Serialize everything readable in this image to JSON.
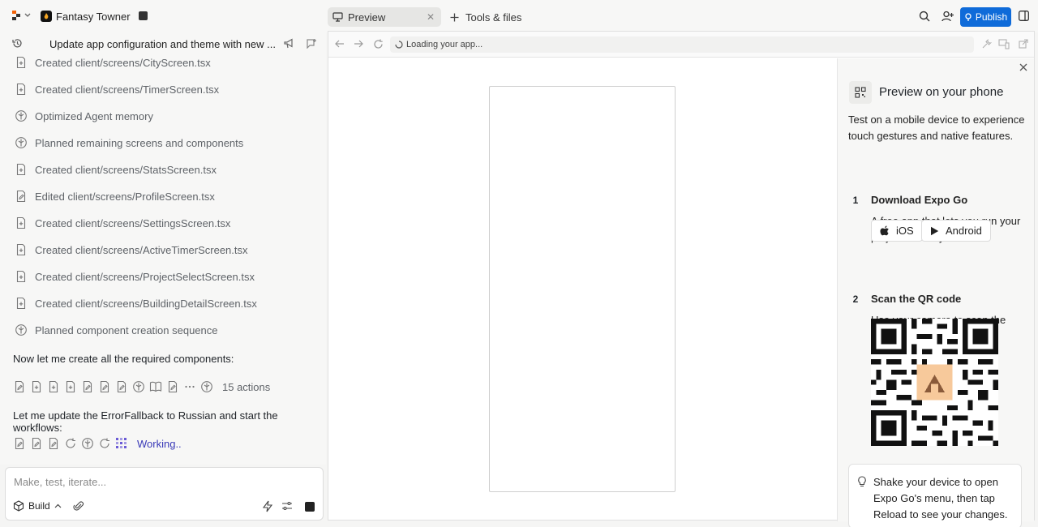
{
  "app": {
    "project_name": "Fantasy Towner",
    "colors": {
      "accent": "#0f6bd9",
      "working": "#3a3ab8"
    }
  },
  "tabs": {
    "preview_label": "Preview",
    "tools_label": "Tools & files"
  },
  "top_actions": {
    "publish_label": "Publish"
  },
  "left": {
    "chat_title": "Update app configuration and theme with new ...",
    "items": [
      {
        "icon": "file-plus-icon",
        "label": "Created client/screens/CityScreen.tsx"
      },
      {
        "icon": "file-plus-icon",
        "label": "Created client/screens/TimerScreen.tsx"
      },
      {
        "icon": "agent-icon",
        "label": "Optimized Agent memory"
      },
      {
        "icon": "agent-icon",
        "label": "Planned remaining screens and components"
      },
      {
        "icon": "file-plus-icon",
        "label": "Created client/screens/StatsScreen.tsx"
      },
      {
        "icon": "file-edit-icon",
        "label": "Edited client/screens/ProfileScreen.tsx"
      },
      {
        "icon": "file-plus-icon",
        "label": "Created client/screens/SettingsScreen.tsx"
      },
      {
        "icon": "file-plus-icon",
        "label": "Created client/screens/ActiveTimerScreen.tsx"
      },
      {
        "icon": "file-plus-icon",
        "label": "Created client/screens/ProjectSelectScreen.tsx"
      },
      {
        "icon": "file-plus-icon",
        "label": "Created client/screens/BuildingDetailScreen.tsx"
      },
      {
        "icon": "agent-icon",
        "label": "Planned component creation sequence"
      }
    ],
    "message_1": "Now let me create all the required components:",
    "actions_count": "15 actions",
    "message_2": "Let me update the ErrorFallback to Russian and start the workflows:",
    "working_label": "Working.."
  },
  "composer": {
    "placeholder": "Make, test, iterate...",
    "mode_label": "Build"
  },
  "preview": {
    "url_text": "Loading your app..."
  },
  "phone_panel": {
    "title": "Preview on your phone",
    "description": "Test on a mobile device to experience touch gestures and native features.",
    "step1_num": "1",
    "step1_title": "Download Expo Go",
    "step1_desc": "A free app that lets you run your project instantly.",
    "ios_label": "iOS",
    "android_label": "Android",
    "step2_num": "2",
    "step2_title": "Scan the QR code",
    "step2_desc": "Use your camera to scan the code and launch Expo Go.",
    "tip": "Shake your device to open Expo Go's menu, then tap Reload to see your changes."
  }
}
